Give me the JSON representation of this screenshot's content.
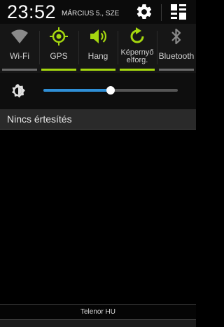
{
  "status": {
    "time": "23:52",
    "date": "MÁRCIUS 5., SZE",
    "settings_icon": "gear-icon",
    "quick_panel_icon": "grid-icon"
  },
  "toggles": [
    {
      "label": "Wi-Fi",
      "icon": "wifi-icon",
      "on": false
    },
    {
      "label": "GPS",
      "icon": "gps-icon",
      "on": true
    },
    {
      "label": "Hang",
      "icon": "sound-icon",
      "on": true
    },
    {
      "label": "Képernyő elforg.",
      "label_line1": "Képernyő",
      "label_line2": "elforg.",
      "icon": "rotate-icon",
      "on": true
    },
    {
      "label": "Bluetooth",
      "icon": "bluetooth-icon",
      "on": false
    }
  ],
  "brightness": {
    "icon": "brightness-auto-icon",
    "level": 0.5
  },
  "notifications": {
    "empty_text": "Nincs értesítés"
  },
  "carrier": "Telenor HU",
  "colors": {
    "accent_on": "#a5d70f",
    "slider": "#2f8fd6",
    "icon_off": "#8a8a8a"
  }
}
